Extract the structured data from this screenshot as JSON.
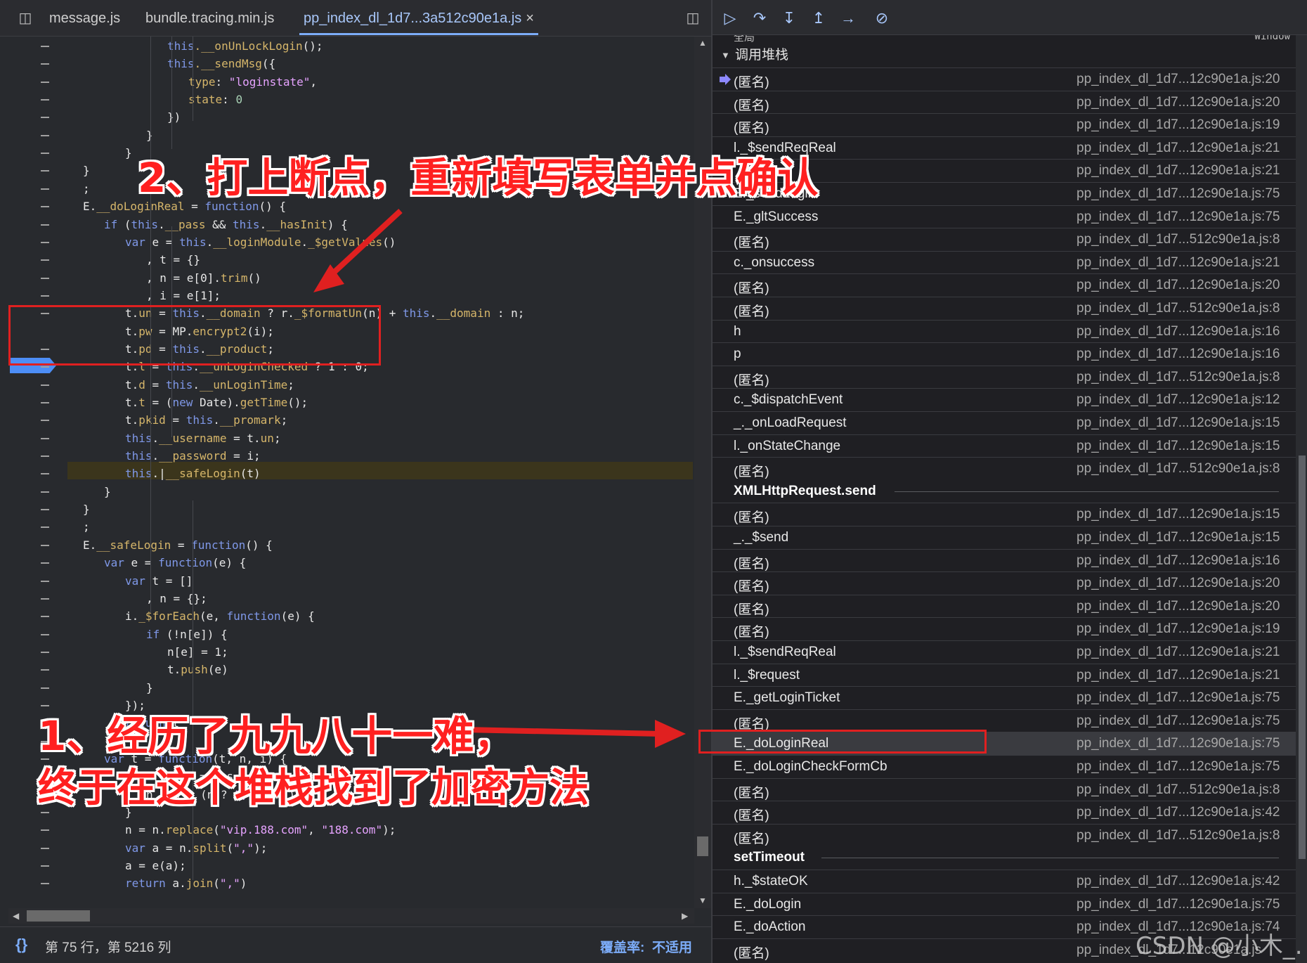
{
  "tabs": [
    {
      "label": "message.js"
    },
    {
      "label": "bundle.tracing.min.js"
    },
    {
      "label": "pp_index_dl_1d7...3a512c90e1a.js",
      "close": "×"
    }
  ],
  "code_lines": [
    [
      {
        "t": "this",
        "c": "kw"
      },
      {
        "t": ".__onUnLockLogin",
        "c": "pr"
      },
      {
        "t": "();"
      }
    ],
    [
      {
        "t": "this",
        "c": "kw"
      },
      {
        "t": ".__sendMsg",
        "c": "pr"
      },
      {
        "t": "({"
      }
    ],
    [
      {
        "t": "type",
        "c": "pr"
      },
      {
        "t": ": "
      },
      {
        "t": "\"loginstate\"",
        "c": "st"
      },
      {
        "t": ","
      }
    ],
    [
      {
        "t": "state",
        "c": "pr"
      },
      {
        "t": ": "
      },
      {
        "t": "0",
        "c": "nm"
      }
    ],
    [
      {
        "t": "})"
      }
    ],
    [
      {
        "t": "}"
      }
    ],
    [
      {
        "t": "}"
      }
    ],
    [
      {
        "t": "}"
      }
    ],
    [
      {
        "t": ";"
      }
    ],
    [
      {
        "t": "E."
      },
      {
        "t": "__doLoginReal",
        "c": "pr"
      },
      {
        "t": " = "
      },
      {
        "t": "function",
        "c": "kw"
      },
      {
        "t": "() {"
      }
    ],
    [
      {
        "t": "if",
        "c": "kw"
      },
      {
        "t": " ("
      },
      {
        "t": "this",
        "c": "kw"
      },
      {
        "t": "."
      },
      {
        "t": "__pass",
        "c": "pr"
      },
      {
        "t": " && "
      },
      {
        "t": "this",
        "c": "kw"
      },
      {
        "t": "."
      },
      {
        "t": "__hasInit",
        "c": "pr"
      },
      {
        "t": ") {"
      }
    ],
    [
      {
        "t": "var",
        "c": "kw"
      },
      {
        "t": " e = "
      },
      {
        "t": "this",
        "c": "kw"
      },
      {
        "t": "."
      },
      {
        "t": "__loginModule",
        "c": "pr"
      },
      {
        "t": "."
      },
      {
        "t": "_$getValues",
        "c": "pr"
      },
      {
        "t": "()"
      }
    ],
    [
      {
        "t": ", t = {}"
      }
    ],
    [
      {
        "t": ", n = e[0]."
      },
      {
        "t": "trim",
        "c": "pr"
      },
      {
        "t": "()"
      }
    ],
    [
      {
        "t": ", i = e[1];"
      }
    ],
    [
      {
        "t": "t."
      },
      {
        "t": "un",
        "c": "pr"
      },
      {
        "t": " = "
      },
      {
        "t": "this",
        "c": "kw"
      },
      {
        "t": "."
      },
      {
        "t": "__domain",
        "c": "pr"
      },
      {
        "t": " ? r."
      },
      {
        "t": "_$formatUn",
        "c": "pr"
      },
      {
        "t": "(n) + "
      },
      {
        "t": "this",
        "c": "kw"
      },
      {
        "t": "."
      },
      {
        "t": "__domain",
        "c": "pr"
      },
      {
        "t": " : n;"
      }
    ],
    [
      {
        "t": "t."
      },
      {
        "t": "pw",
        "c": "pr"
      },
      {
        "t": " = "
      },
      {
        "t": "MP.",
        "c": ""
      },
      {
        "t": "encrypt2",
        "c": "pr"
      },
      {
        "t": "(i);"
      }
    ],
    [
      {
        "t": "t."
      },
      {
        "t": "pd",
        "c": "pr"
      },
      {
        "t": " = "
      },
      {
        "t": "this",
        "c": "kw"
      },
      {
        "t": "."
      },
      {
        "t": "__product",
        "c": "pr"
      },
      {
        "t": ";"
      }
    ],
    [
      {
        "t": "t."
      },
      {
        "t": "l",
        "c": "pr"
      },
      {
        "t": " = "
      },
      {
        "t": "this",
        "c": "kw"
      },
      {
        "t": "."
      },
      {
        "t": "__unLoginChecked",
        "c": "pr"
      },
      {
        "t": " ? 1 : 0;"
      }
    ],
    [
      {
        "t": "t."
      },
      {
        "t": "d",
        "c": "pr"
      },
      {
        "t": " = "
      },
      {
        "t": "this",
        "c": "kw"
      },
      {
        "t": "."
      },
      {
        "t": "__unLoginTime",
        "c": "pr"
      },
      {
        "t": ";"
      }
    ],
    [
      {
        "t": "t."
      },
      {
        "t": "t",
        "c": "pr"
      },
      {
        "t": " = ("
      },
      {
        "t": "new",
        "c": "kw"
      },
      {
        "t": " Date)."
      },
      {
        "t": "getTime",
        "c": "pr"
      },
      {
        "t": "();"
      }
    ],
    [
      {
        "t": "t."
      },
      {
        "t": "pkid",
        "c": "pr"
      },
      {
        "t": " = "
      },
      {
        "t": "this",
        "c": "kw"
      },
      {
        "t": "."
      },
      {
        "t": "__promark",
        "c": "pr"
      },
      {
        "t": ";"
      }
    ],
    [
      {
        "t": "this",
        "c": "kw"
      },
      {
        "t": "."
      },
      {
        "t": "__username",
        "c": "pr"
      },
      {
        "t": " = t."
      },
      {
        "t": "un",
        "c": "pr"
      },
      {
        "t": ";"
      }
    ],
    [
      {
        "t": "this",
        "c": "kw"
      },
      {
        "t": "."
      },
      {
        "t": "__password",
        "c": "pr"
      },
      {
        "t": " = i;"
      }
    ],
    [
      {
        "t": "this",
        "c": "kw"
      },
      {
        "t": ".|"
      },
      {
        "t": "__safeLogin",
        "c": "pr"
      },
      {
        "t": "(t)"
      }
    ],
    [
      {
        "t": "}"
      }
    ],
    [
      {
        "t": "}"
      }
    ],
    [
      {
        "t": ";"
      }
    ],
    [
      {
        "t": "E."
      },
      {
        "t": "__safeLogin",
        "c": "pr"
      },
      {
        "t": " = "
      },
      {
        "t": "function",
        "c": "kw"
      },
      {
        "t": "() {"
      }
    ],
    [
      {
        "t": "var",
        "c": "kw"
      },
      {
        "t": " e = "
      },
      {
        "t": "function",
        "c": "kw"
      },
      {
        "t": "(e) {"
      }
    ],
    [
      {
        "t": "var",
        "c": "kw"
      },
      {
        "t": " t = []"
      }
    ],
    [
      {
        "t": ", n = {};"
      }
    ],
    [
      {
        "t": "i."
      },
      {
        "t": "_$forEach",
        "c": "pr"
      },
      {
        "t": "(e, "
      },
      {
        "t": "function",
        "c": "kw"
      },
      {
        "t": "(e) {"
      }
    ],
    [
      {
        "t": "if",
        "c": "kw"
      },
      {
        "t": " (!n[e]) {"
      }
    ],
    [
      {
        "t": "n[e] = 1;"
      }
    ],
    [
      {
        "t": "t."
      },
      {
        "t": "push",
        "c": "pr"
      },
      {
        "t": "(e)"
      }
    ],
    [
      {
        "t": "}"
      }
    ],
    [
      {
        "t": "});"
      }
    ],
    [
      {
        "t": "return",
        "c": "kw"
      },
      {
        "t": " t"
      }
    ],
    [
      {
        "t": "}"
      }
    ],
    [
      {
        "t": "var",
        "c": "kw"
      },
      {
        "t": " t = "
      },
      {
        "t": "function",
        "c": "kw"
      },
      {
        "t": "(t, n, i) {"
      }
    ],
    [
      {
        "t": "for",
        "c": "kw"
      },
      {
        "t": " ("
      },
      {
        "t": "var",
        "c": "kw"
      },
      {
        "t": " r = t.s"
      }
    ],
    [
      {
        "t": "n = n + (n ? "
      },
      {
        "t": "\",\"",
        "c": "st"
      },
      {
        "t": " : "
      },
      {
        "t": "\"\"",
        "c": "st"
      },
      {
        "t": ") + r"
      }
    ],
    [
      {
        "t": "}"
      }
    ],
    [
      {
        "t": "n = n."
      },
      {
        "t": "replace",
        "c": "pr"
      },
      {
        "t": "("
      },
      {
        "t": "\"vip.188.com\"",
        "c": "st"
      },
      {
        "t": ", "
      },
      {
        "t": "\"188.com\"",
        "c": "st"
      },
      {
        "t": ");"
      }
    ],
    [
      {
        "t": "var",
        "c": "kw"
      },
      {
        "t": " a = n."
      },
      {
        "t": "split",
        "c": "pr"
      },
      {
        "t": "("
      },
      {
        "t": "\",\"",
        "c": "st"
      },
      {
        "t": ");"
      }
    ],
    [
      {
        "t": "a = e(a);"
      }
    ],
    [
      {
        "t": "return",
        "c": "kw"
      },
      {
        "t": " a."
      },
      {
        "t": "join",
        "c": "pr"
      },
      {
        "t": "("
      },
      {
        "t": "\",\"",
        "c": "st"
      },
      {
        "t": ")"
      }
    ]
  ],
  "code_indent": [
    5,
    5,
    6,
    6,
    5,
    4,
    3,
    1,
    1,
    1,
    2,
    3,
    4,
    4,
    4,
    3,
    3,
    3,
    3,
    3,
    3,
    3,
    3,
    3,
    3,
    2,
    1,
    1,
    1,
    2,
    3,
    4,
    3,
    4,
    5,
    5,
    4,
    3,
    3,
    2,
    2,
    3,
    4,
    3,
    3,
    3,
    3,
    3
  ],
  "status": {
    "position": "第 75 行，第 5216 列",
    "coverage_label": "覆盖率:",
    "coverage_value": "不适用",
    "braces_icon": "{}"
  },
  "debugger": {
    "scope_label": "全局",
    "window_label": "Window",
    "callstack_title": "调用堆栈"
  },
  "call_stack": [
    {
      "name": "(匿名)",
      "loc": "pp_index_dl_1d7...12c90e1a.js:20",
      "current": true
    },
    {
      "name": "(匿名)",
      "loc": "pp_index_dl_1d7...12c90e1a.js:20"
    },
    {
      "name": "(匿名)",
      "loc": "pp_index_dl_1d7...12c90e1a.js:19"
    },
    {
      "name": "l._$sendReqReal",
      "loc": "pp_index_dl_1d7...12c90e1a.js:21"
    },
    {
      "name": "",
      "loc": "pp_index_dl_1d7...12c90e1a.js:21"
    },
    {
      "name": "E._sendLogin",
      "loc": "pp_index_dl_1d7...12c90e1a.js:75"
    },
    {
      "name": "E._gltSuccess",
      "loc": "pp_index_dl_1d7...12c90e1a.js:75"
    },
    {
      "name": "(匿名)",
      "loc": "pp_index_dl_1d7...512c90e1a.js:8"
    },
    {
      "name": "c._onsuccess",
      "loc": "pp_index_dl_1d7...12c90e1a.js:21"
    },
    {
      "name": "(匿名)",
      "loc": "pp_index_dl_1d7...12c90e1a.js:20"
    },
    {
      "name": "(匿名)",
      "loc": "pp_index_dl_1d7...512c90e1a.js:8"
    },
    {
      "name": "h",
      "loc": "pp_index_dl_1d7...12c90e1a.js:16"
    },
    {
      "name": "p",
      "loc": "pp_index_dl_1d7...12c90e1a.js:16"
    },
    {
      "name": "(匿名)",
      "loc": "pp_index_dl_1d7...512c90e1a.js:8"
    },
    {
      "name": "c._$dispatchEvent",
      "loc": "pp_index_dl_1d7...12c90e1a.js:12"
    },
    {
      "name": "_._onLoadRequest",
      "loc": "pp_index_dl_1d7...12c90e1a.js:15"
    },
    {
      "name": "l._onStateChange",
      "loc": "pp_index_dl_1d7...12c90e1a.js:15"
    },
    {
      "name": "(匿名)",
      "loc": "pp_index_dl_1d7...512c90e1a.js:8"
    },
    {
      "async": "XMLHttpRequest.send"
    },
    {
      "name": "(匿名)",
      "loc": "pp_index_dl_1d7...12c90e1a.js:15"
    },
    {
      "name": "_._$send",
      "loc": "pp_index_dl_1d7...12c90e1a.js:15"
    },
    {
      "name": "(匿名)",
      "loc": "pp_index_dl_1d7...12c90e1a.js:16"
    },
    {
      "name": "(匿名)",
      "loc": "pp_index_dl_1d7...12c90e1a.js:20"
    },
    {
      "name": "(匿名)",
      "loc": "pp_index_dl_1d7...12c90e1a.js:20"
    },
    {
      "name": "(匿名)",
      "loc": "pp_index_dl_1d7...12c90e1a.js:19"
    },
    {
      "name": "l._$sendReqReal",
      "loc": "pp_index_dl_1d7...12c90e1a.js:21"
    },
    {
      "name": "l._$request",
      "loc": "pp_index_dl_1d7...12c90e1a.js:21"
    },
    {
      "name": "E._getLoginTicket",
      "loc": "pp_index_dl_1d7...12c90e1a.js:75"
    },
    {
      "name": "(匿名)",
      "loc": "pp_index_dl_1d7...12c90e1a.js:75"
    },
    {
      "name": "E._doLoginReal",
      "loc": "pp_index_dl_1d7...12c90e1a.js:75",
      "selected": true
    },
    {
      "name": "E._doLoginCheckFormCb",
      "loc": "pp_index_dl_1d7...12c90e1a.js:75"
    },
    {
      "name": "(匿名)",
      "loc": "pp_index_dl_1d7...512c90e1a.js:8"
    },
    {
      "name": "(匿名)",
      "loc": "pp_index_dl_1d7...12c90e1a.js:42"
    },
    {
      "name": "(匿名)",
      "loc": "pp_index_dl_1d7...512c90e1a.js:8"
    },
    {
      "async": "setTimeout"
    },
    {
      "name": "h._$stateOK",
      "loc": "pp_index_dl_1d7...12c90e1a.js:42"
    },
    {
      "name": "E._doLogin",
      "loc": "pp_index_dl_1d7...12c90e1a.js:75"
    },
    {
      "name": "E._doAction",
      "loc": "pp_index_dl_1d7...12c90e1a.js:74"
    },
    {
      "name": "(匿名)",
      "loc": "pp_index_dl_1d7...12c90e1a.js"
    }
  ],
  "annotations": {
    "step2": "2、打上断点，重新填写表单并点确认",
    "step1_line1": "1、经历了九九八十一难，",
    "step1_line2": "终于在这个堆栈找到了加密方法"
  },
  "watermark": "CSDN @小木_.",
  "colors": {
    "accent": "#7cacf8",
    "annotation_red": "#e02020",
    "breakpoint_blue": "#4d8ef7",
    "paused_line": "#3b351c"
  }
}
